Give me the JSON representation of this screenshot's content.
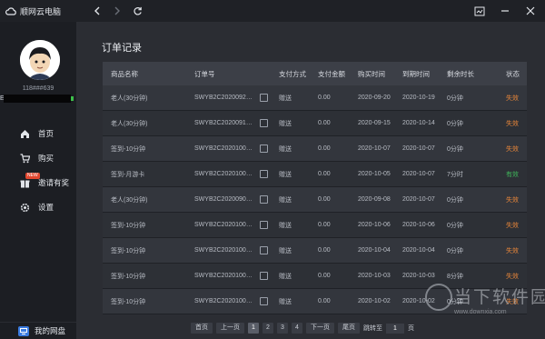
{
  "app": {
    "title": "顺网云电脑"
  },
  "user": {
    "id": "118###639",
    "redacted_prefix": "E"
  },
  "sidebar": {
    "items": [
      {
        "label": "首页",
        "icon": "home-icon"
      },
      {
        "label": "购买",
        "icon": "cart-icon"
      },
      {
        "label": "邀请有奖",
        "icon": "gift-icon",
        "badge": "NEW"
      },
      {
        "label": "设置",
        "icon": "gear-icon"
      }
    ],
    "netdisk": {
      "label": "我的网盘",
      "icon": "netdisk-icon"
    }
  },
  "page": {
    "title": "订单记录"
  },
  "table": {
    "headers": [
      "商品名称",
      "订单号",
      "支付方式",
      "支付金额",
      "购买时间",
      "到期时间",
      "剩余时长",
      "状态"
    ],
    "rows": [
      {
        "product": "老人(30分钟)",
        "order_no": "SWYB2C2020092…",
        "pay": "赠送",
        "amount": "0.00",
        "buy": "2020-09-20",
        "expire": "2020-10-19",
        "remain": "0分钟",
        "status": "失效",
        "status_kind": "expired"
      },
      {
        "product": "老人(30分钟)",
        "order_no": "SWYB2C2020091…",
        "pay": "赠送",
        "amount": "0.00",
        "buy": "2020-09-15",
        "expire": "2020-10-14",
        "remain": "0分钟",
        "status": "失效",
        "status_kind": "expired"
      },
      {
        "product": "签到-10分钟",
        "order_no": "SWYB2C2020100…",
        "pay": "赠送",
        "amount": "0.00",
        "buy": "2020-10-07",
        "expire": "2020-10-07",
        "remain": "0分钟",
        "status": "失效",
        "status_kind": "expired"
      },
      {
        "product": "签到-月游卡",
        "order_no": "SWYB2C2020100…",
        "pay": "赠送",
        "amount": "0.00",
        "buy": "2020-10-05",
        "expire": "2020-10-07",
        "remain": "7分时",
        "status": "有效",
        "status_kind": "valid"
      },
      {
        "product": "老人(30分钟)",
        "order_no": "SWYB2C2020090…",
        "pay": "赠送",
        "amount": "0.00",
        "buy": "2020-09-08",
        "expire": "2020-10-07",
        "remain": "0分钟",
        "status": "失效",
        "status_kind": "expired"
      },
      {
        "product": "签到-10分钟",
        "order_no": "SWYB2C2020100…",
        "pay": "赠送",
        "amount": "0.00",
        "buy": "2020-10-06",
        "expire": "2020-10-06",
        "remain": "0分钟",
        "status": "失效",
        "status_kind": "expired"
      },
      {
        "product": "签到-10分钟",
        "order_no": "SWYB2C2020100…",
        "pay": "赠送",
        "amount": "0.00",
        "buy": "2020-10-04",
        "expire": "2020-10-04",
        "remain": "0分钟",
        "status": "失效",
        "status_kind": "expired"
      },
      {
        "product": "签到-10分钟",
        "order_no": "SWYB2C2020100…",
        "pay": "赠送",
        "amount": "0.00",
        "buy": "2020-10-03",
        "expire": "2020-10-03",
        "remain": "8分钟",
        "status": "失效",
        "status_kind": "expired"
      },
      {
        "product": "签到-10分钟",
        "order_no": "SWYB2C2020100…",
        "pay": "赠送",
        "amount": "0.00",
        "buy": "2020-10-02",
        "expire": "2020-10-02",
        "remain": "0分钟",
        "status": "失效",
        "status_kind": "expired"
      }
    ]
  },
  "pagination": {
    "first": "首页",
    "prev": "上一页",
    "pages": [
      "1",
      "2",
      "3",
      "4"
    ],
    "current": "1",
    "next": "下一页",
    "last": "尾页",
    "jump_label": "跳转至",
    "jump_value": "1",
    "page_suffix": "页"
  },
  "watermark": {
    "text": "当下软件园",
    "url": "www.downxia.com"
  },
  "colors": {
    "expired": "#e8863a",
    "valid": "#3fb55a",
    "badge": "#e2472f",
    "accent": "#3a7be0"
  }
}
